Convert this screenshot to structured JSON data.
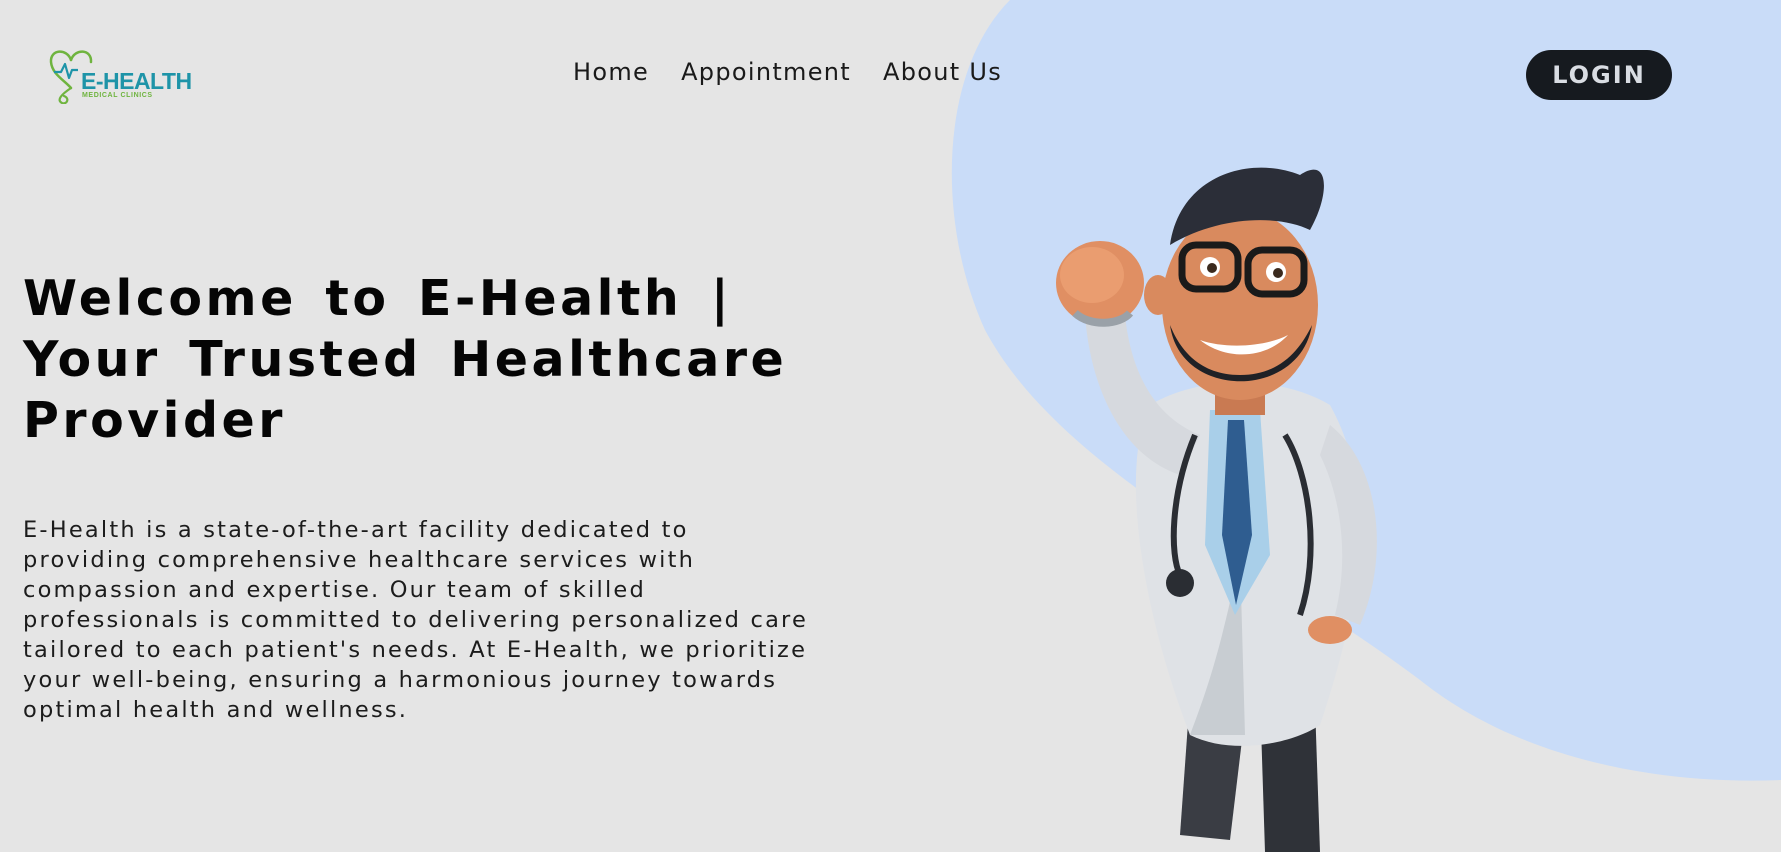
{
  "logo": {
    "brand": "E-HEALTH",
    "tagline": "MEDICAL CLINICS"
  },
  "nav": [
    {
      "label": "Home"
    },
    {
      "label": "Appointment"
    },
    {
      "label": "About Us"
    }
  ],
  "login_label": "LOGIN",
  "hero": {
    "title": "Welcome to E-Health | Your Trusted Healthcare Provider",
    "description": "E-Health is a state-of-the-art facility dedicated to providing comprehensive healthcare services with compassion and expertise. Our team of skilled professionals is committed to delivering personalized care tailored to each patient's needs. At E-Health, we prioritize your well-being, ensuring a harmonious journey towards optimal health and wellness."
  },
  "colors": {
    "background": "#e5e5e5",
    "blob": "#c9dcf8",
    "brand_teal": "#1e94a8",
    "brand_green": "#6fb43f",
    "login_bg": "#161a1f"
  },
  "icons": {
    "logo_mark": "heart-stethoscope-icon",
    "hero_image": "cartoon-doctor-illustration"
  }
}
